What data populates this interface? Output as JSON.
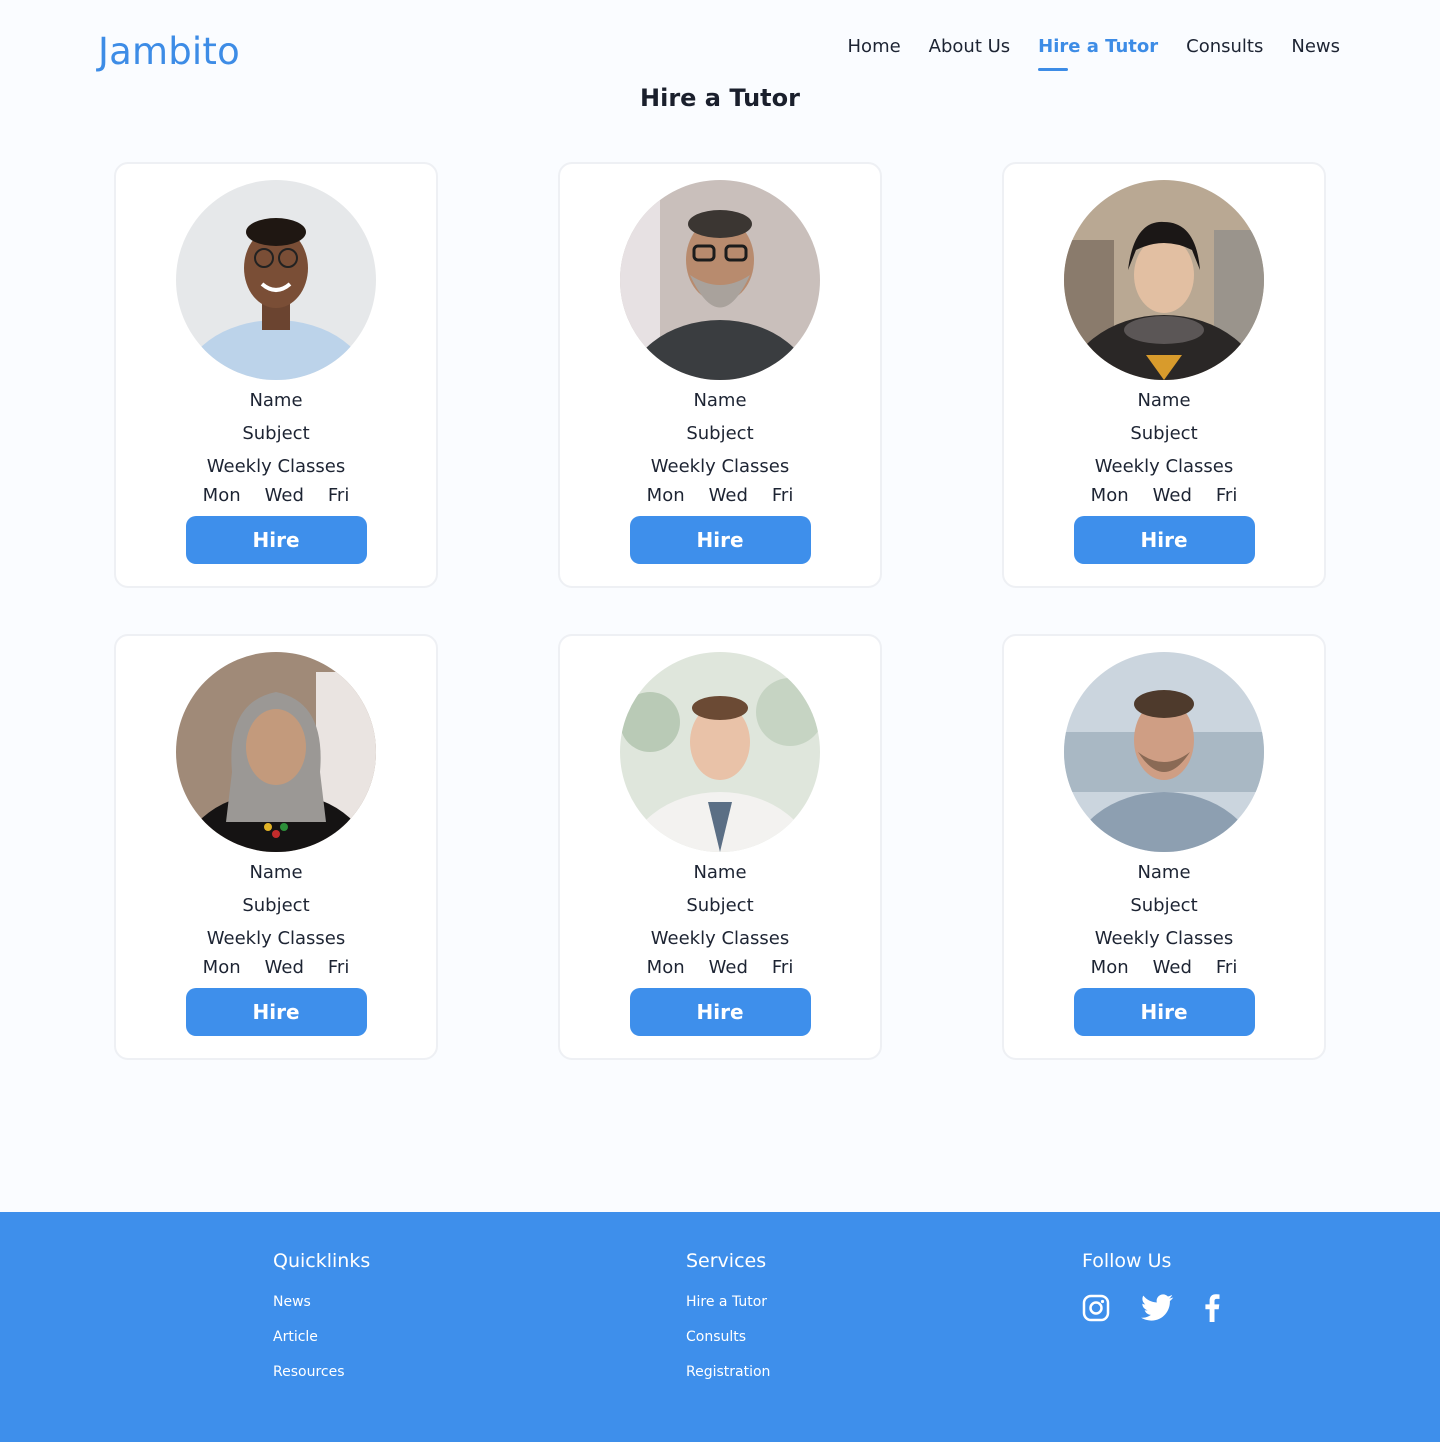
{
  "brand": {
    "logo": "Jambito"
  },
  "nav": {
    "items": [
      {
        "label": "Home"
      },
      {
        "label": "About Us"
      },
      {
        "label": "Hire a Tutor",
        "active": true
      },
      {
        "label": "Consults"
      },
      {
        "label": "News"
      }
    ]
  },
  "page": {
    "title": "Hire a Tutor"
  },
  "tutors": [
    {
      "name": "Name",
      "subject": "Subject",
      "weekly": "Weekly Classes",
      "days": [
        "Mon",
        "Wed",
        "Fri"
      ],
      "button": "Hire"
    },
    {
      "name": "Name",
      "subject": "Subject",
      "weekly": "Weekly Classes",
      "days": [
        "Mon",
        "Wed",
        "Fri"
      ],
      "button": "Hire"
    },
    {
      "name": "Name",
      "subject": "Subject",
      "weekly": "Weekly Classes",
      "days": [
        "Mon",
        "Wed",
        "Fri"
      ],
      "button": "Hire"
    },
    {
      "name": "Name",
      "subject": "Subject",
      "weekly": "Weekly Classes",
      "days": [
        "Mon",
        "Wed",
        "Fri"
      ],
      "button": "Hire"
    },
    {
      "name": "Name",
      "subject": "Subject",
      "weekly": "Weekly Classes",
      "days": [
        "Mon",
        "Wed",
        "Fri"
      ],
      "button": "Hire"
    },
    {
      "name": "Name",
      "subject": "Subject",
      "weekly": "Weekly Classes",
      "days": [
        "Mon",
        "Wed",
        "Fri"
      ],
      "button": "Hire"
    }
  ],
  "footer": {
    "quicklinks": {
      "title": "Quicklinks",
      "links": [
        "News",
        "Article",
        "Resources"
      ]
    },
    "services": {
      "title": "Services",
      "links": [
        "Hire a Tutor",
        "Consults",
        "Registration"
      ]
    },
    "follow": {
      "title": "Follow Us",
      "icons": [
        "instagram-icon",
        "twitter-icon",
        "facebook-icon"
      ]
    }
  },
  "colors": {
    "accent": "#3e8feb",
    "logo": "#3d8ce6",
    "background": "#fafcff"
  }
}
